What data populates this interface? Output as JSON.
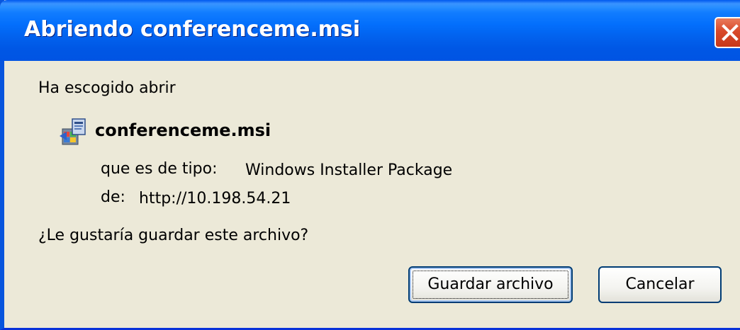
{
  "window": {
    "title": "Abriendo conferenceme.msi"
  },
  "dialog": {
    "intro": "Ha escogido abrir",
    "file_name": "conferenceme.msi",
    "type_label": "que es de tipo:",
    "type_value": "Windows Installer Package",
    "from_label": "de:",
    "from_value": "http://10.198.54.21",
    "question": "¿Le gustaría guardar este archivo?"
  },
  "buttons": {
    "save": "Guardar archivo",
    "cancel": "Cancelar"
  },
  "icons": {
    "file": "windows-installer-package-icon",
    "close": "close-icon"
  },
  "colors": {
    "titlebar": "#0054e3",
    "dialog_bg": "#ece9d8",
    "close_button": "#d8492a"
  }
}
